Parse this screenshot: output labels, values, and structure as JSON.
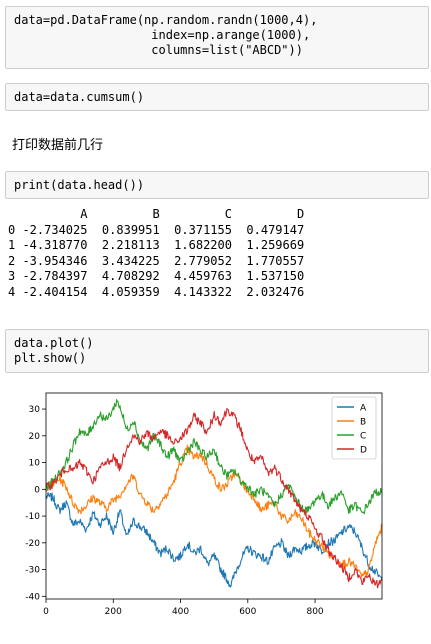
{
  "cells": {
    "cell1_lines": [
      "data=pd.DataFrame(np.random.randn(1000,4),",
      "                   index=np.arange(1000),",
      "                   columns=list(\"ABCD\"))"
    ],
    "cell2_line": "data=data.cumsum()",
    "markdown": "打印数据前几行",
    "cell3_line": "print(data.head())",
    "cell4_lines": [
      "data.plot()",
      "plt.show()"
    ]
  },
  "table_output": {
    "header": "          A         B         C         D",
    "rows": [
      "0 -2.734025  0.839951  0.371155  0.479147",
      "1 -4.318770  2.218113  1.682200  1.259669",
      "2 -3.954346  3.434225  2.779052  1.770557",
      "3 -2.784397  4.708292  4.459763  1.537150",
      "4 -2.404154  4.059359  4.143322  2.032476"
    ]
  },
  "chart_data": {
    "type": "line",
    "title": "",
    "xlabel": "",
    "ylabel": "",
    "xlim": [
      0,
      999
    ],
    "ylim": [
      -41,
      36
    ],
    "xticks": [
      0,
      200,
      400,
      600,
      800
    ],
    "yticks": [
      -40,
      -30,
      -20,
      -10,
      0,
      10,
      20,
      30
    ],
    "legend_position": "top-right",
    "grid": false,
    "series": [
      {
        "name": "A",
        "color": "#1f77b4",
        "anchors": [
          [
            0,
            -2.7
          ],
          [
            20,
            -3
          ],
          [
            40,
            -8
          ],
          [
            60,
            -5
          ],
          [
            80,
            -13
          ],
          [
            100,
            -12
          ],
          [
            120,
            -15
          ],
          [
            140,
            -9
          ],
          [
            160,
            -13
          ],
          [
            180,
            -10
          ],
          [
            200,
            -16
          ],
          [
            220,
            -8
          ],
          [
            240,
            -18
          ],
          [
            260,
            -12
          ],
          [
            280,
            -14
          ],
          [
            300,
            -16
          ],
          [
            320,
            -20
          ],
          [
            340,
            -24
          ],
          [
            360,
            -22
          ],
          [
            380,
            -26
          ],
          [
            400,
            -25
          ],
          [
            420,
            -20
          ],
          [
            440,
            -24
          ],
          [
            460,
            -22
          ],
          [
            480,
            -28
          ],
          [
            500,
            -25
          ],
          [
            520,
            -30
          ],
          [
            540,
            -34
          ],
          [
            550,
            -36
          ],
          [
            560,
            -32
          ],
          [
            580,
            -26
          ],
          [
            600,
            -22
          ],
          [
            620,
            -24
          ],
          [
            640,
            -25
          ],
          [
            660,
            -27
          ],
          [
            680,
            -22
          ],
          [
            700,
            -20
          ],
          [
            720,
            -25
          ],
          [
            740,
            -22
          ],
          [
            760,
            -23
          ],
          [
            780,
            -21
          ],
          [
            800,
            -20
          ],
          [
            820,
            -23
          ],
          [
            840,
            -20
          ],
          [
            860,
            -19
          ],
          [
            880,
            -16
          ],
          [
            900,
            -14
          ],
          [
            920,
            -16
          ],
          [
            940,
            -22
          ],
          [
            960,
            -28
          ],
          [
            980,
            -31
          ],
          [
            999,
            -34
          ]
        ]
      },
      {
        "name": "B",
        "color": "#ff7f0e",
        "anchors": [
          [
            0,
            0.8
          ],
          [
            20,
            2
          ],
          [
            40,
            4
          ],
          [
            60,
            1
          ],
          [
            80,
            -5
          ],
          [
            100,
            -8
          ],
          [
            120,
            -6
          ],
          [
            140,
            -3
          ],
          [
            160,
            -5
          ],
          [
            180,
            -7
          ],
          [
            200,
            -4
          ],
          [
            220,
            -2
          ],
          [
            240,
            2
          ],
          [
            260,
            5
          ],
          [
            280,
            -2
          ],
          [
            300,
            -5
          ],
          [
            320,
            -8
          ],
          [
            340,
            -5
          ],
          [
            360,
            -2
          ],
          [
            380,
            3
          ],
          [
            400,
            10
          ],
          [
            420,
            15
          ],
          [
            440,
            12
          ],
          [
            460,
            13
          ],
          [
            480,
            9
          ],
          [
            500,
            4
          ],
          [
            520,
            0
          ],
          [
            540,
            2
          ],
          [
            560,
            6
          ],
          [
            580,
            3
          ],
          [
            600,
            -1
          ],
          [
            620,
            -3
          ],
          [
            640,
            -8
          ],
          [
            660,
            -6
          ],
          [
            680,
            -5
          ],
          [
            700,
            -10
          ],
          [
            720,
            -12
          ],
          [
            740,
            -9
          ],
          [
            760,
            -11
          ],
          [
            780,
            -16
          ],
          [
            800,
            -19
          ],
          [
            820,
            -21
          ],
          [
            840,
            -24
          ],
          [
            860,
            -26
          ],
          [
            880,
            -28
          ],
          [
            900,
            -27
          ],
          [
            920,
            -29
          ],
          [
            940,
            -33
          ],
          [
            960,
            -30
          ],
          [
            980,
            -20
          ],
          [
            999,
            -14
          ]
        ]
      },
      {
        "name": "C",
        "color": "#2ca02c",
        "anchors": [
          [
            0,
            0.4
          ],
          [
            20,
            3
          ],
          [
            40,
            6
          ],
          [
            60,
            10
          ],
          [
            80,
            16
          ],
          [
            100,
            22
          ],
          [
            120,
            20
          ],
          [
            140,
            24
          ],
          [
            160,
            28
          ],
          [
            180,
            26
          ],
          [
            200,
            30
          ],
          [
            210,
            33
          ],
          [
            220,
            31
          ],
          [
            240,
            22
          ],
          [
            260,
            26
          ],
          [
            280,
            18
          ],
          [
            300,
            15
          ],
          [
            320,
            20
          ],
          [
            340,
            17
          ],
          [
            360,
            12
          ],
          [
            380,
            15
          ],
          [
            400,
            10
          ],
          [
            420,
            14
          ],
          [
            440,
            18
          ],
          [
            460,
            14
          ],
          [
            480,
            12
          ],
          [
            500,
            15
          ],
          [
            520,
            8
          ],
          [
            540,
            5
          ],
          [
            560,
            7
          ],
          [
            580,
            3
          ],
          [
            600,
            1
          ],
          [
            620,
            -2
          ],
          [
            640,
            0
          ],
          [
            660,
            -3
          ],
          [
            680,
            -6
          ],
          [
            700,
            -2
          ],
          [
            720,
            2
          ],
          [
            740,
            -3
          ],
          [
            760,
            -7
          ],
          [
            780,
            -8
          ],
          [
            800,
            -4
          ],
          [
            820,
            -2
          ],
          [
            840,
            -6
          ],
          [
            860,
            -3
          ],
          [
            880,
            -1
          ],
          [
            900,
            -8
          ],
          [
            920,
            -6
          ],
          [
            940,
            -9
          ],
          [
            960,
            -5
          ],
          [
            980,
            -1
          ],
          [
            999,
            -1
          ]
        ]
      },
      {
        "name": "D",
        "color": "#d62728",
        "anchors": [
          [
            0,
            0.5
          ],
          [
            20,
            2
          ],
          [
            40,
            5
          ],
          [
            60,
            8
          ],
          [
            80,
            7
          ],
          [
            100,
            10
          ],
          [
            120,
            7
          ],
          [
            140,
            3
          ],
          [
            160,
            8
          ],
          [
            180,
            10
          ],
          [
            200,
            12
          ],
          [
            220,
            8
          ],
          [
            240,
            16
          ],
          [
            260,
            20
          ],
          [
            280,
            18
          ],
          [
            300,
            21
          ],
          [
            320,
            19
          ],
          [
            340,
            22
          ],
          [
            360,
            20
          ],
          [
            380,
            17
          ],
          [
            400,
            19
          ],
          [
            420,
            22
          ],
          [
            440,
            27
          ],
          [
            460,
            25
          ],
          [
            480,
            21
          ],
          [
            500,
            28
          ],
          [
            520,
            25
          ],
          [
            540,
            30
          ],
          [
            560,
            27
          ],
          [
            580,
            22
          ],
          [
            600,
            14
          ],
          [
            620,
            10
          ],
          [
            640,
            12
          ],
          [
            660,
            6
          ],
          [
            680,
            8
          ],
          [
            700,
            4
          ],
          [
            720,
            0
          ],
          [
            740,
            -4
          ],
          [
            760,
            -8
          ],
          [
            780,
            -10
          ],
          [
            800,
            -15
          ],
          [
            820,
            -18
          ],
          [
            840,
            -23
          ],
          [
            860,
            -26
          ],
          [
            880,
            -29
          ],
          [
            900,
            -33
          ],
          [
            920,
            -30
          ],
          [
            940,
            -35
          ],
          [
            960,
            -32
          ],
          [
            980,
            -36
          ],
          [
            999,
            -34
          ]
        ]
      }
    ]
  }
}
